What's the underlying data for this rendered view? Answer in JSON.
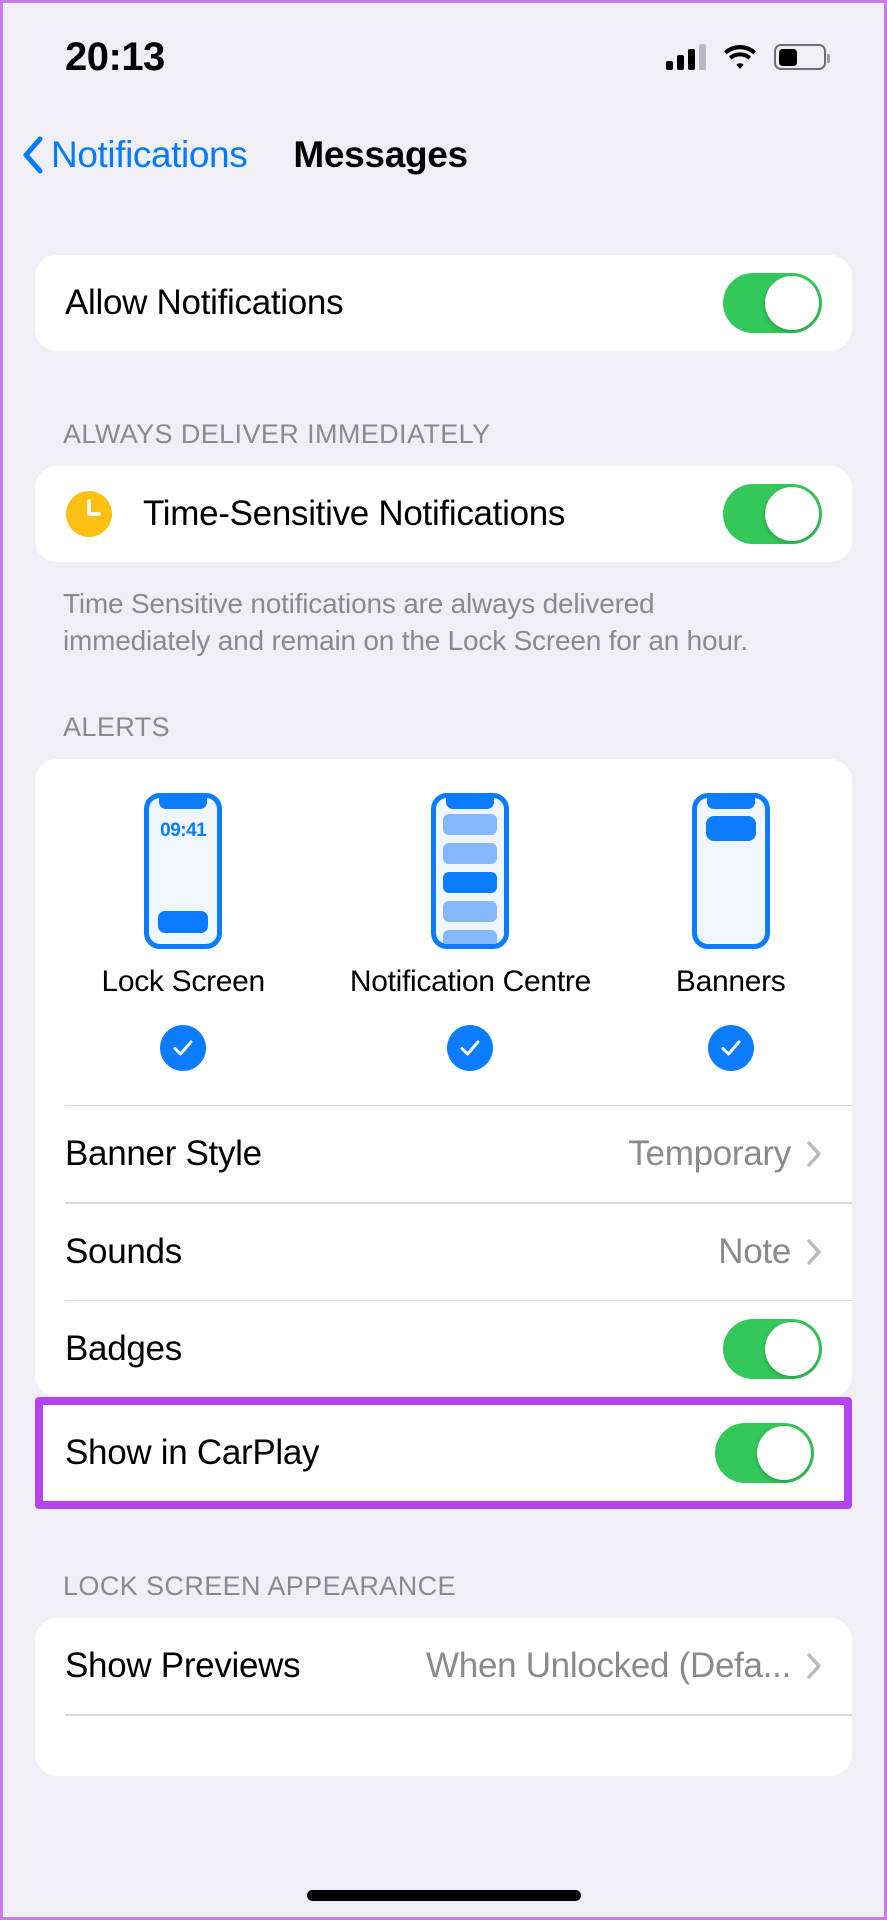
{
  "status_bar": {
    "time": "20:13",
    "cellular_icon": "cellular-signal-icon",
    "wifi_icon": "wifi-icon",
    "battery_icon": "battery-icon"
  },
  "nav": {
    "back_icon": "chevron-left-icon",
    "back_label": "Notifications",
    "title": "Messages"
  },
  "allow_section": {
    "label": "Allow Notifications",
    "toggle_on": true
  },
  "time_sensitive_section": {
    "header": "ALWAYS DELIVER IMMEDIATELY",
    "icon": "clock-icon",
    "label": "Time-Sensitive Notifications",
    "toggle_on": true,
    "footnote": "Time Sensitive notifications are always delivered immediately and remain on the Lock Screen for an hour."
  },
  "alerts_section": {
    "header": "ALERTS",
    "styles": [
      {
        "label": "Lock Screen",
        "selected": true,
        "preview_time": "09:41"
      },
      {
        "label": "Notification Centre",
        "selected": true
      },
      {
        "label": "Banners",
        "selected": true
      }
    ],
    "rows": [
      {
        "label": "Banner Style",
        "value": "Temporary",
        "type": "disclosure"
      },
      {
        "label": "Sounds",
        "value": "Note",
        "type": "disclosure"
      },
      {
        "label": "Badges",
        "type": "toggle",
        "toggle_on": true
      },
      {
        "label": "Show in CarPlay",
        "type": "toggle",
        "toggle_on": true,
        "highlighted": true
      }
    ]
  },
  "lock_screen_appearance": {
    "header": "LOCK SCREEN APPEARANCE",
    "row": {
      "label": "Show Previews",
      "value": "When Unlocked (Defa...",
      "type": "disclosure"
    }
  },
  "colors": {
    "accent_blue": "#007aff",
    "toggle_green": "#34c759",
    "highlight_purple": "#b444f0",
    "preview_blue": "#0a7cff",
    "clock_yellow": "#fcc014",
    "page_background": "#f0eff5"
  }
}
